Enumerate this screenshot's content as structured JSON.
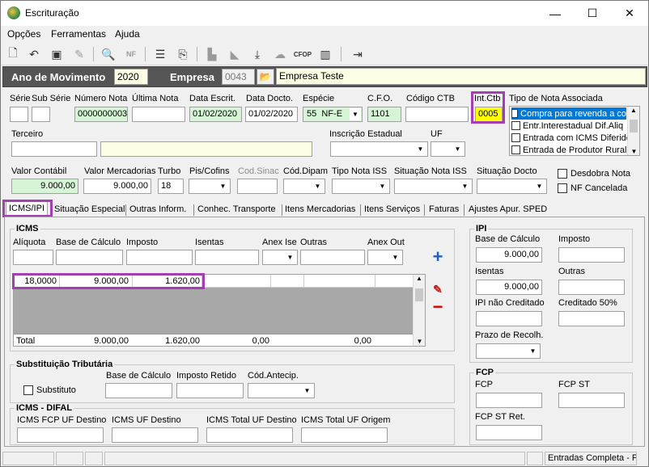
{
  "window": {
    "title": "Escrituração",
    "minimize": "—",
    "maximize": "☐",
    "close": "✕"
  },
  "menu": {
    "opcoes": "Opções",
    "ferramentas": "Ferramentas",
    "ajuda": "Ajuda"
  },
  "toolbar_icons": [
    "new-file-icon",
    "undo-icon",
    "save-icon",
    "clear-icon",
    "print-preview-icon",
    "nfe-icon",
    "list-icon",
    "export-icon",
    "folder-icon",
    "folder-open-icon",
    "download-icon",
    "cloud-icon",
    "cfop-icon",
    "book-icon",
    "exit-icon"
  ],
  "header": {
    "ano_label": "Ano de Movimento",
    "ano_value": "2020",
    "empresa_label": "Empresa",
    "empresa_code": "0043",
    "empresa_name": "Empresa Teste"
  },
  "row1": {
    "serie_label": "Série",
    "sub_serie_label": "Sub Série",
    "numero_nota_label": "Número Nota",
    "numero_nota_value": "0000000003",
    "ultima_nota_label": "Última Nota",
    "data_escrit_label": "Data Escrit.",
    "data_escrit_value": "01/02/2020",
    "data_docto_label": "Data Docto.",
    "data_docto_value": "01/02/2020",
    "especie_label": "Espécie",
    "especie_code": "55",
    "especie_value": "NF-E",
    "cfo_label": "C.F.O.",
    "cfo_value": "1101",
    "codigo_ctb_label": "Código CTB",
    "int_ctb_label": "Int.Ctb",
    "int_ctb_value": "0005",
    "tipo_nota_label": "Tipo de Nota Associada",
    "tipo_nota_items": [
      "Compra para revenda a co",
      "Entr.Interestadual Dif.Aliq",
      "Entrada com ICMS Diferido",
      "Entrada de Produtor Rural"
    ]
  },
  "row2": {
    "terceiro_label": "Terceiro",
    "inscricao_label": "Inscrição Estadual",
    "uf_label": "UF"
  },
  "row3": {
    "valor_contabil_label": "Valor Contábil",
    "valor_contabil_value": "9.000,00",
    "valor_mercadorias_label": "Valor Mercadorias",
    "valor_mercadorias_value": "9.000,00",
    "turbo_label": "Turbo",
    "turbo_value": "18",
    "pis_label": "Pis/Cofins",
    "cod_sinac_label": "Cod.Sinac",
    "cod_dipam_label": "Cód.Dipam",
    "tipo_nota_iss_label": "Tipo Nota ISS",
    "situacao_nota_iss_label": "Situação Nota ISS",
    "situacao_docto_label": "Situação Docto",
    "desdobra_label": "Desdobra Nota",
    "nf_cancelada_label": "NF Cancelada"
  },
  "tabs": [
    "ICMS/IPI",
    "Situação Especial",
    "Outras Inform.",
    "Conhec. Transporte",
    "Itens Mercadorias",
    "Itens Serviços",
    "Faturas",
    "Ajustes Apur. SPED"
  ],
  "icms": {
    "title": "ICMS",
    "aliquota_label": "Alíquota",
    "base_label": "Base de Cálculo",
    "imposto_label": "Imposto",
    "isentas_label": "Isentas",
    "anex_ise_label": "Anex Ise",
    "outras_label": "Outras",
    "anex_out_label": "Anex Out",
    "row": {
      "aliquota": "18,0000",
      "base": "9.000,00",
      "imposto": "1.620,00"
    },
    "total": {
      "label": "Total",
      "base": "9.000,00",
      "imposto": "1.620,00",
      "isentas": "0,00",
      "outras": "0,00"
    }
  },
  "ipi": {
    "title": "IPI",
    "base_label": "Base de Cálculo",
    "base_value": "9.000,00",
    "imposto_label": "Imposto",
    "isentas_label": "Isentas",
    "isentas_value": "9.000,00",
    "outras_label": "Outras",
    "nao_creditado_label": "IPI não Creditado",
    "creditado50_label": "Creditado 50%",
    "prazo_label": "Prazo de Recolh."
  },
  "st": {
    "title": "Substituição Tributária",
    "substituto_label": "Substituto",
    "base_label": "Base de Cálculo",
    "imposto_retido_label": "Imposto Retido",
    "cod_antecip_label": "Cód.Antecip."
  },
  "difal": {
    "title": "ICMS - DIFAL",
    "fcp_uf_destino_label": "ICMS FCP UF Destino",
    "uf_destino_label": "ICMS UF Destino",
    "total_uf_destino_label": "ICMS Total UF Destino",
    "total_uf_origem_label": "ICMS Total UF Origem"
  },
  "fcp": {
    "title": "FCP",
    "fcp_label": "FCP",
    "fcp_st_label": "FCP ST",
    "fcp_st_ret_label": "FCP ST Ret."
  },
  "status": {
    "right": "Entradas Completa - P"
  },
  "colors": {
    "highlight": "#a33fb0",
    "dark_bar": "#555555",
    "green_field": "#d6f5d6",
    "yellow_field": "#ffffc8"
  }
}
